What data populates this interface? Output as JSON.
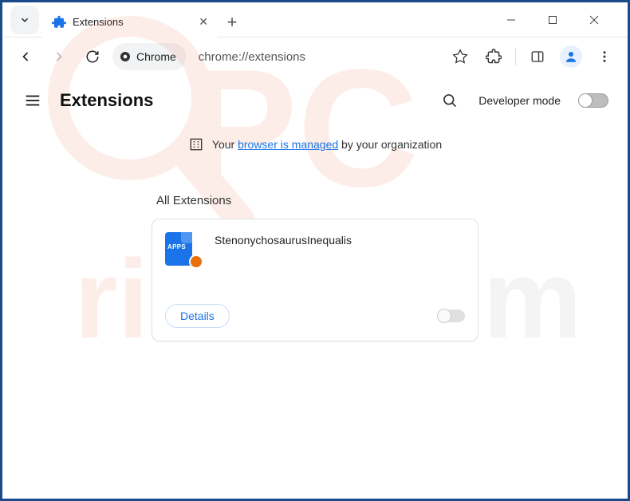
{
  "titlebar": {
    "tab_title": "Extensions"
  },
  "toolbar": {
    "chrome_chip": "Chrome",
    "url": "chrome://extensions"
  },
  "header": {
    "title": "Extensions",
    "dev_mode_label": "Developer mode",
    "dev_mode_on": false
  },
  "managed_banner": {
    "prefix": "Your ",
    "link": "browser is managed",
    "suffix": " by your organization"
  },
  "section": {
    "label": "All Extensions"
  },
  "extension": {
    "icon_text": "APPS",
    "name": "StenonychosaurusInequalis",
    "details_label": "Details",
    "enabled": false
  },
  "watermark": "PCrisk.com"
}
